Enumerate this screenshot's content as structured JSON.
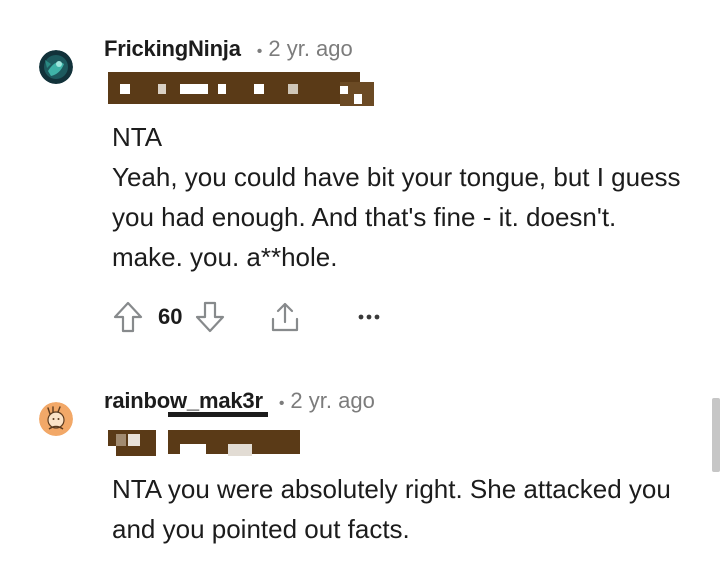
{
  "comments": [
    {
      "username": "FrickingNinja",
      "separator": "•",
      "timestamp": "2 yr. ago",
      "body": [
        "NTA",
        "Yeah, you could have bit your tongue, but I guess you had enough. And that's fine - it. doesn't. make. you. a**hole."
      ],
      "votes": "60",
      "more": "•••"
    },
    {
      "username": "rainbow_mak3r",
      "separator": "•",
      "timestamp": "2 yr. ago",
      "body": [
        "NTA you were absolutely right. She attacked you and you pointed out facts."
      ]
    }
  ],
  "colors": {
    "text": "#1c1c1c",
    "meta": "#7c7c7c",
    "icon": "#878a8c",
    "flair_redaction": "#5a3a17"
  },
  "icons": [
    "upvote-icon",
    "downvote-icon",
    "share-icon",
    "more-options-icon"
  ]
}
